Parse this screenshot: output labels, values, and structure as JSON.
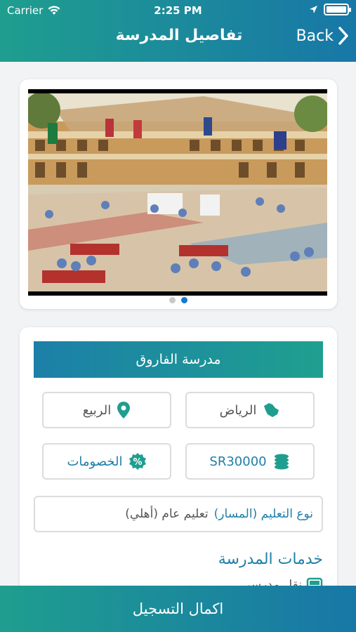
{
  "status_bar": {
    "carrier": "Carrier",
    "time": "2:25 PM"
  },
  "header": {
    "title": "تفاصيل المدرسة",
    "back_label": "Back"
  },
  "gallery": {
    "total": 2,
    "active_index": 1
  },
  "school": {
    "name": "مدرسة الفاروق",
    "city": "الرياض",
    "district": "الربيع",
    "price": "SR30000",
    "discounts": "الخصومات",
    "education_type_label": "نوع التعليم (المسار)",
    "education_type_value": "تعليم عام (أهلي)"
  },
  "services": {
    "title": "خدمات المدرسة",
    "first_item": "نقل مدرسي"
  },
  "footer": {
    "register_label": "اكمال التسجيل"
  },
  "colors": {
    "teal": "#1f9e8f",
    "blue": "#1877a7",
    "accent_text": "#1f7fa8",
    "active_dot": "#1877d2"
  },
  "icons": [
    "wifi-icon",
    "location-arrow-icon",
    "battery-icon",
    "chevron-right-icon",
    "map-pin-icon",
    "saudi-map-icon",
    "percent-badge-icon",
    "coins-icon",
    "bus-icon"
  ]
}
